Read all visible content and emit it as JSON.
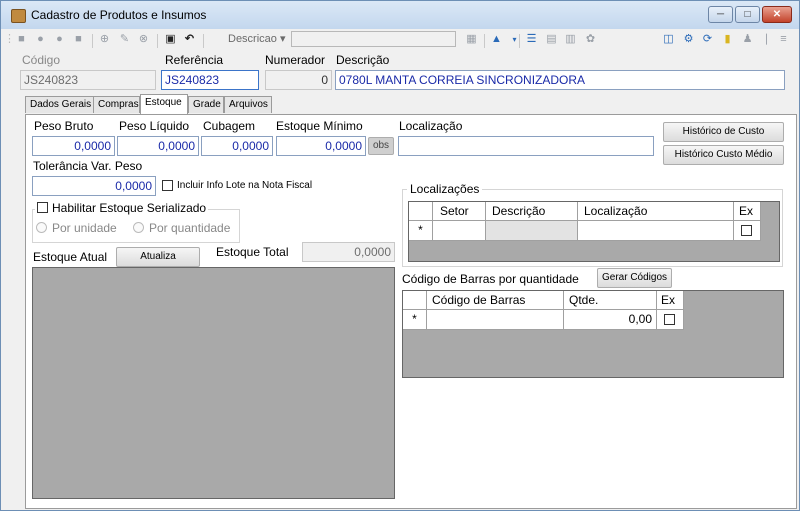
{
  "window": {
    "title": "Cadastro de Produtos e Insumos",
    "controls": {
      "minimize": "─",
      "maximize": "□",
      "close": "✕"
    }
  },
  "toolbar": {
    "dropdown_label": "Descricao ▾",
    "search_value": ""
  },
  "header": {
    "codigo_label": "Código",
    "codigo_value": "JS240823",
    "referencia_label": "Referência",
    "referencia_value": "JS240823",
    "numerador_label": "Numerador",
    "numerador_value": "0",
    "descricao_label": "Descrição",
    "descricao_value": "0780L MANTA CORREIA SINCRONIZADORA"
  },
  "tabs": [
    {
      "label": "Dados Gerais"
    },
    {
      "label": "Compras"
    },
    {
      "label": "Estoque"
    },
    {
      "label": "Grade"
    },
    {
      "label": "Arquivos"
    }
  ],
  "estoque": {
    "peso_bruto_label": "Peso Bruto",
    "peso_bruto_value": "0,0000",
    "peso_liquido_label": "Peso Líquido",
    "peso_liquido_value": "0,0000",
    "cubagem_label": "Cubagem",
    "cubagem_value": "0,0000",
    "estoque_minimo_label": "Estoque Mínimo",
    "estoque_minimo_value": "0,0000",
    "obs_button": "obs",
    "localizacao_label": "Localização",
    "localizacao_value": "",
    "historico_custo_button": "Histórico de Custo",
    "historico_custo_medio_button": "Histórico Custo Médio",
    "tolerancia_label": "Tolerância Var. Peso",
    "tolerancia_value": "0,0000",
    "incluir_lote_label": "Incluir Info Lote na Nota Fiscal",
    "serializado_label": "Habilitar Estoque Serializado",
    "por_unidade_label": "Por unidade",
    "por_quantidade_label": "Por quantidade",
    "estoque_atual_label": "Estoque Atual",
    "atualiza_button": "Atualiza",
    "estoque_total_label": "Estoque Total",
    "estoque_total_value": "0,0000"
  },
  "localizacoes": {
    "title": "Localizações",
    "columns": [
      "Setor",
      "Descrição",
      "Localização",
      "Ex"
    ],
    "row_marker": "*"
  },
  "codigo_barras": {
    "title": "Código de Barras por quantidade",
    "gerar_button": "Gerar Códigos",
    "columns": [
      "Código de Barras",
      "Qtde.",
      "Ex"
    ],
    "row_marker": "*",
    "row_qtde": "0,00"
  }
}
